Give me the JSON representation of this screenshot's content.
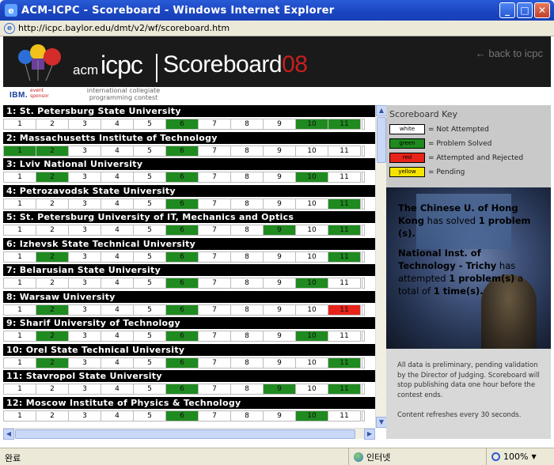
{
  "window": {
    "title": "ACM-ICPC - Scoreboard - Windows Internet Explorer",
    "min": "_",
    "max": "□",
    "close": "✕"
  },
  "address": {
    "url": "http://icpc.baylor.edu/dmt/v2/wf/scoreboard.htm"
  },
  "banner": {
    "acm": "acm",
    "icpc": "icpc",
    "scoreboard": "Scoreboard",
    "year": "08",
    "back_link": "← back to icpc",
    "ibm": "IBM.",
    "event_sponsor": "event sponsor",
    "icpc_full": "international collegiate programming contest"
  },
  "problem_labels": [
    "1",
    "2",
    "3",
    "4",
    "5",
    "6",
    "7",
    "8",
    "9",
    "10",
    "11"
  ],
  "teams": [
    {
      "name": "1: St. Petersburg State University",
      "status": [
        "w",
        "w",
        "w",
        "w",
        "w",
        "g",
        "w",
        "w",
        "w",
        "g",
        "g"
      ]
    },
    {
      "name": "2: Massachusetts Institute of Technology",
      "status": [
        "g",
        "g",
        "w",
        "w",
        "w",
        "g",
        "w",
        "w",
        "w",
        "w",
        "w"
      ]
    },
    {
      "name": "3: Lviv National University",
      "status": [
        "w",
        "g",
        "w",
        "w",
        "w",
        "g",
        "w",
        "w",
        "w",
        "g",
        "w"
      ]
    },
    {
      "name": "4: Petrozavodsk State University",
      "status": [
        "w",
        "w",
        "w",
        "w",
        "w",
        "g",
        "w",
        "w",
        "w",
        "w",
        "g"
      ]
    },
    {
      "name": "5: St. Petersburg University of IT, Mechanics and Optics",
      "status": [
        "w",
        "w",
        "w",
        "w",
        "w",
        "g",
        "w",
        "w",
        "g",
        "w",
        "g"
      ]
    },
    {
      "name": "6: Izhevsk State Technical University",
      "status": [
        "w",
        "g",
        "w",
        "w",
        "w",
        "g",
        "w",
        "w",
        "w",
        "w",
        "g"
      ]
    },
    {
      "name": "7: Belarusian State University",
      "status": [
        "w",
        "w",
        "w",
        "w",
        "w",
        "g",
        "w",
        "w",
        "w",
        "g",
        "w"
      ]
    },
    {
      "name": "8: Warsaw University",
      "status": [
        "w",
        "g",
        "w",
        "w",
        "w",
        "g",
        "w",
        "w",
        "w",
        "w",
        "r"
      ]
    },
    {
      "name": "9: Sharif University of Technology",
      "status": [
        "w",
        "g",
        "w",
        "w",
        "w",
        "g",
        "w",
        "w",
        "w",
        "g",
        "w"
      ]
    },
    {
      "name": "10: Orel State Technical University",
      "status": [
        "w",
        "g",
        "w",
        "w",
        "w",
        "g",
        "w",
        "w",
        "w",
        "w",
        "g"
      ]
    },
    {
      "name": "11: Stavropol State University",
      "status": [
        "w",
        "w",
        "w",
        "w",
        "w",
        "g",
        "w",
        "w",
        "g",
        "w",
        "g"
      ]
    },
    {
      "name": "12: Moscow Institute of Physics & Technology",
      "status": [
        "w",
        "w",
        "w",
        "w",
        "w",
        "g",
        "w",
        "w",
        "w",
        "g",
        "w"
      ]
    }
  ],
  "key": {
    "title": "Scoreboard Key",
    "items": [
      {
        "swatch": "white",
        "label": "= Not Attempted",
        "color": "#ffffff"
      },
      {
        "swatch": "green",
        "label": "= Problem Solved",
        "color": "#1f8a1f"
      },
      {
        "swatch": "red",
        "label": "= Attempted and Rejected",
        "color": "#e8231a"
      },
      {
        "swatch": "yellow",
        "label": "= Pending",
        "color": "#f6e400"
      }
    ]
  },
  "news": {
    "p1_team": "The Chinese U. of Hong Kong",
    "p1_mid": " has solved ",
    "p1_count": "1 problem (s).",
    "p2_team": "National Inst. of Technology - Trichy",
    "p2_mid": " has attempted ",
    "p2_count": "1 problem(s)",
    "p2_tail": " a total of ",
    "p2_times": "1 time(s)."
  },
  "disclaimer": "All data is preliminary, pending validation by the Director of Judging. Scoreboard will stop publishing data one hour before the contest ends.",
  "refresh": "Content refreshes every 30 seconds.",
  "status": {
    "done": "완료",
    "zone": "인터넷",
    "zoom": "100%"
  },
  "colors": {
    "solved": "#1f8a1f",
    "rejected": "#e8231a",
    "pending": "#f6e400",
    "titlebar": "#2a5bd7"
  }
}
